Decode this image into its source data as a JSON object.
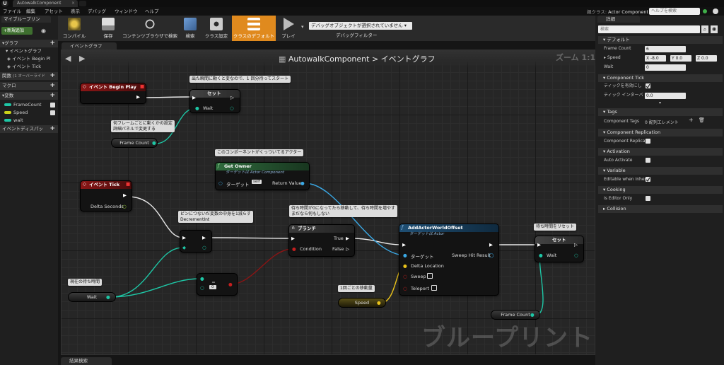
{
  "window": {
    "tab_title": "AutowalkComponent",
    "parent_class_label": "親クラス:",
    "parent_class": "Actor Component",
    "help_search_placeholder": "ヘルプを検索"
  },
  "menu": [
    "ファイル",
    "編集",
    "アセット",
    "表示",
    "デバッグ",
    "ウィンドウ",
    "ヘルプ"
  ],
  "left_panel": {
    "tab": "マイブループリン",
    "add_button": "+新規追加",
    "rows": [
      {
        "label": "グラフ",
        "type": "header"
      },
      {
        "label": "イベントグラフ",
        "type": "item",
        "indent": 1
      },
      {
        "label": "イベント Begin Pl",
        "type": "item",
        "indent": 2
      },
      {
        "label": "イベント Tick",
        "type": "item",
        "indent": 2
      },
      {
        "label": "関数",
        "type": "header",
        "extra": "(1 オーバーライド"
      },
      {
        "label": "マクロ",
        "type": "header"
      },
      {
        "label": "変数",
        "type": "header"
      },
      {
        "label": "FrameCount",
        "type": "var",
        "color": "#1ec7a6"
      },
      {
        "label": "Speed",
        "type": "var",
        "color": "#c9d21a"
      },
      {
        "label": "wait",
        "type": "var",
        "color": "#1ec7a6"
      },
      {
        "label": "イベントディスパッ",
        "type": "header"
      }
    ]
  },
  "toolbar": {
    "buttons": [
      {
        "label": "コンパイル"
      },
      {
        "label": "保存"
      },
      {
        "label": "コンテンツブラウザで検索"
      },
      {
        "label": "検索"
      },
      {
        "label": "クラス設定"
      },
      {
        "label": "クラスのデフォルト",
        "active": true
      },
      {
        "label": "プレイ"
      }
    ],
    "debug_object": "デバッグオブジェクトが選択されていません",
    "debug_filter": "デバッグフィルター"
  },
  "graph": {
    "tab": "イベントグラフ",
    "breadcrumb": "AutowalkComponent > イベントグラフ",
    "zoom": "ズーム 1:1",
    "watermark": "ブループリント",
    "comments": {
      "c1": "出た瞬間に動くと変なので、1 回分待ってスタート",
      "c2a": "何フレームごとに動くかの設定",
      "c2b": "詳細パネルで変更する",
      "c3": "このコンポーネントがくっついてるアクター",
      "c4a": "ピンにつないだ変数の中身を1減らす",
      "c4b": "DecrementInt",
      "c5a": "待ち時間が0になってたら移動して、待ち時間を増やす",
      "c5b": "まだなら何もしない",
      "c6": "現在の待ち時間",
      "c7": "1回ごとの移動量",
      "c8": "待ち時間をリセット"
    },
    "nodes": {
      "begin_play": "イベント Begin Play",
      "set1": "セット",
      "set1_wait": "Wait",
      "frame_count_1": "Frame Count",
      "get_owner": "Get Owner",
      "get_owner_sub": "ターゲットは Actor Component",
      "get_owner_target": "ターゲット",
      "get_owner_self": "self",
      "get_owner_return": "Return Value",
      "tick": "イベント Tick",
      "delta_seconds": "Delta Seconds",
      "branch": "ブランチ",
      "branch_true": "True",
      "branch_false": "False",
      "branch_condition": "Condition",
      "add_offset": "AddActorWorldOffset",
      "add_offset_sub": "ターゲットは Actor",
      "add_offset_target": "ターゲット",
      "add_offset_delta": "Delta Location",
      "add_offset_sweep": "Sweep",
      "add_offset_teleport": "Teleport",
      "add_offset_hit": "Sweep Hit Result",
      "wait_var": "Wait",
      "equal_zero": "0",
      "speed_var": "Speed",
      "set2": "セット",
      "set2_wait": "Wait",
      "frame_count_2": "Frame Count"
    }
  },
  "details": {
    "tab": "詳細",
    "search_placeholder": "検索",
    "sections": {
      "default": "デフォルト",
      "component_tick": "Component Tick",
      "tags": "Tags",
      "replication": "Component Replication",
      "activation": "Activation",
      "variable": "Variable",
      "cooking": "Cooking",
      "collision": "Collision"
    },
    "frame_count_label": "Frame Count",
    "frame_count_value": "6",
    "speed_label": "Speed",
    "speed_x": "X -8.0",
    "speed_y": "Y 0.0",
    "speed_z": "Z 0.0",
    "wait_label": "Wait",
    "wait_value": "0",
    "tick_enabled_label": "ティックを有効にし",
    "tick_interval_label": "ティック インターバ",
    "tick_interval_value": "0.0",
    "tags_label": "Component Tags",
    "tags_value": "0 配列エレメント",
    "replicates_label": "Component Replicat",
    "auto_activate_label": "Auto Activate",
    "editable_label": "Editable when Inheri",
    "editor_only_label": "Is Editor Only"
  },
  "bottom_tab": "結果検索",
  "colors": {
    "exec": "#ffffff",
    "int_pin": "#1ec7a6",
    "vector_pin": "#e9c21a",
    "bool_pin": "#8c1414",
    "object_pin": "#3aa9e6",
    "active_button": "#e08a1e"
  }
}
